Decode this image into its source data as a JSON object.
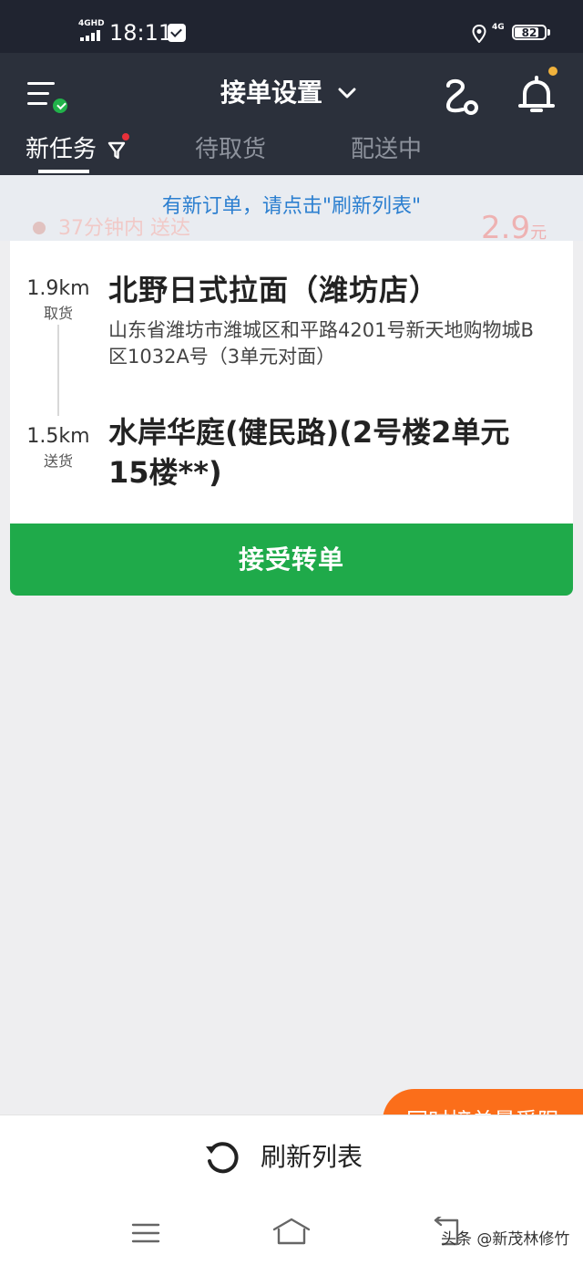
{
  "status_bar": {
    "network": "4GHD",
    "time": "18:11",
    "mobile_data": "4G",
    "battery_percent": "82",
    "battery_level": 0.82
  },
  "header": {
    "title": "接单设置",
    "tabs": [
      "新任务",
      "待取货",
      "配送中"
    ],
    "active_tab": 0
  },
  "notice": {
    "text": "有新订单，请点击\"刷新列表\"",
    "time_hint": "37分钟内 送达",
    "price": "2.9",
    "price_unit": "元"
  },
  "order": {
    "pickup_distance": "1.9km",
    "pickup_label": "取货",
    "shop_name": "北野日式拉面（潍坊店）",
    "shop_address": "山东省潍坊市潍城区和平路4201号新天地购物城B区1032A号（3单元对面）",
    "delivery_distance": "1.5km",
    "delivery_label": "送货",
    "destination": "水岸华庭(健民路)(2号楼2单元15楼**)",
    "accept_label": "接受转单"
  },
  "footer": {
    "refresh_label": "刷新列表",
    "limit_label": "同时接单量受限"
  },
  "watermark": "头条 @新茂林修竹",
  "colors": {
    "header_bg": "#2b303b",
    "accent_green": "#1faa4a",
    "notice_blue": "#2c7fd0",
    "limit_orange": "#fb6e1a"
  }
}
